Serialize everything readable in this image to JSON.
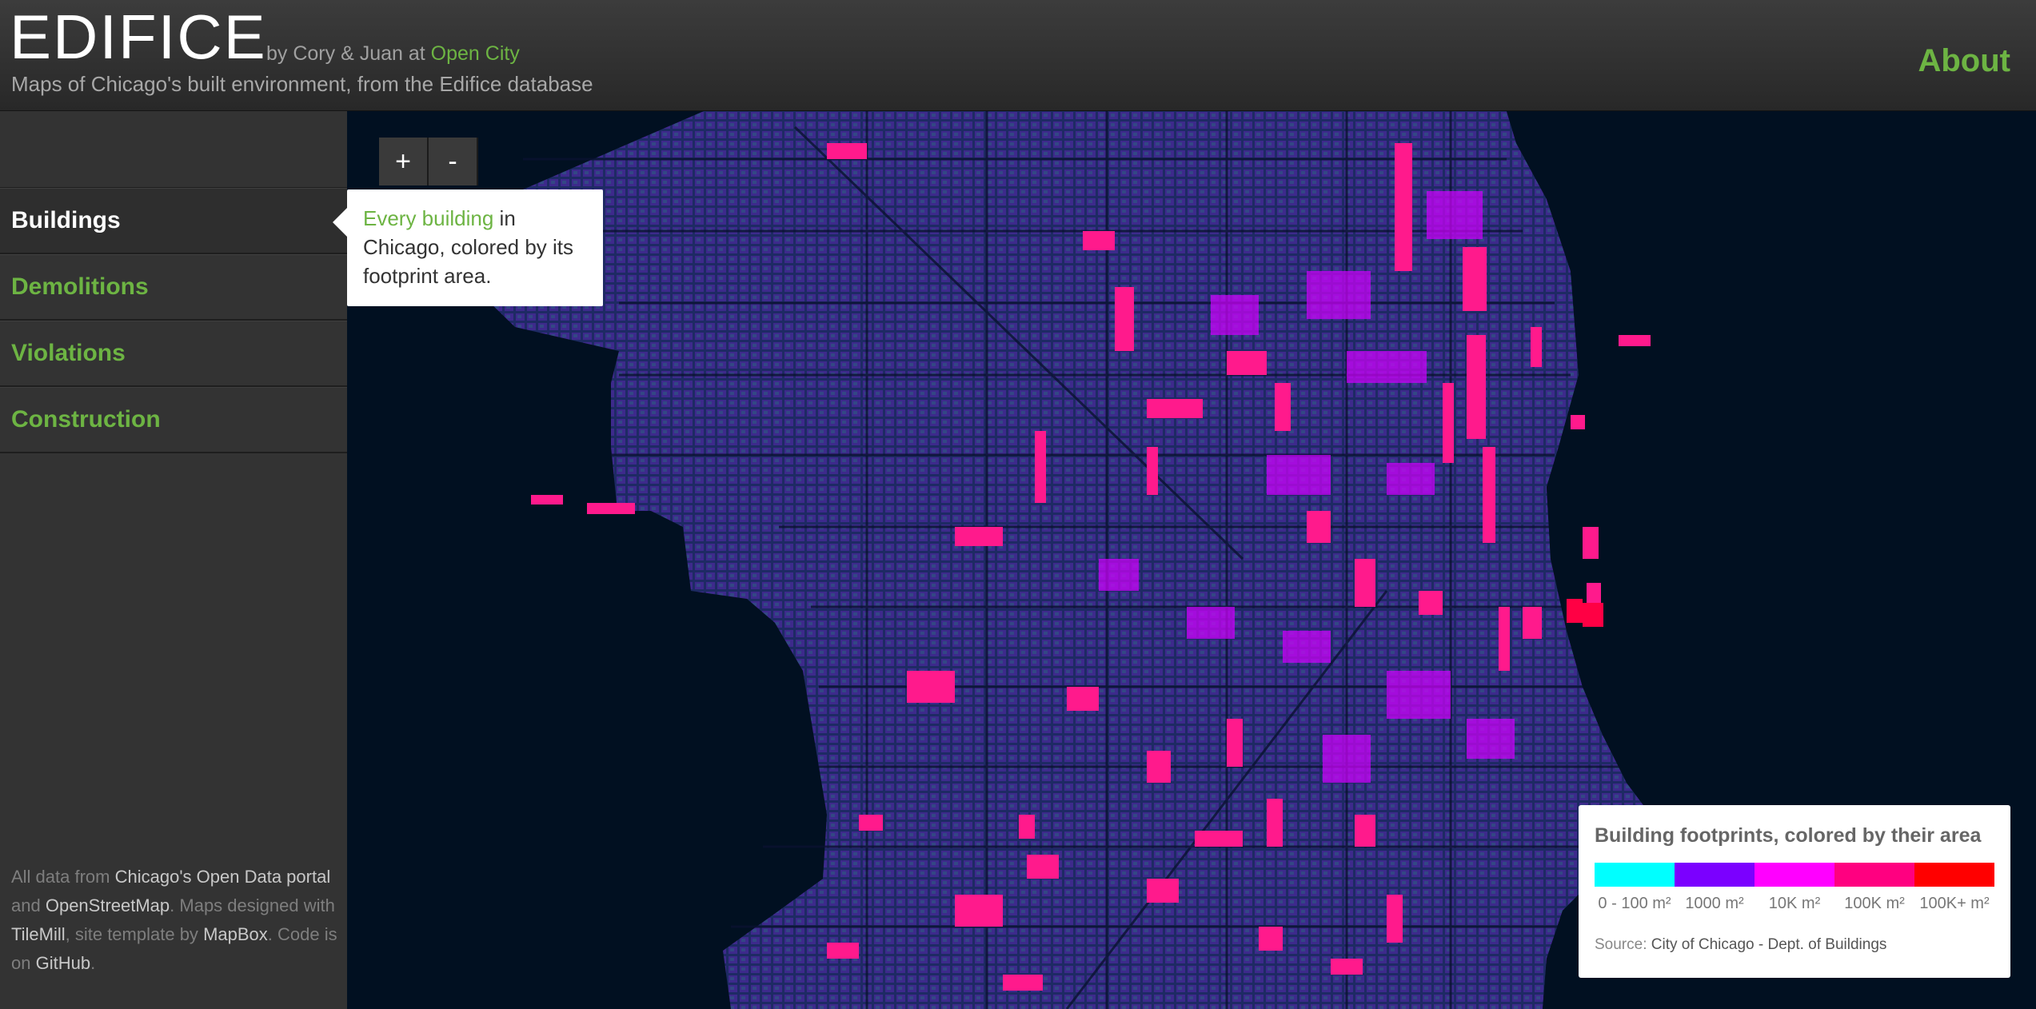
{
  "header": {
    "logo": "EDIFICE",
    "byline_prefix": "by Cory & Juan at",
    "byline_link": "Open City",
    "tagline": "Maps of Chicago's built environment, from the Edifice database",
    "about_label": "About"
  },
  "sidebar": {
    "items": [
      {
        "label": "Buildings",
        "active": true
      },
      {
        "label": "Demolitions",
        "active": false
      },
      {
        "label": "Violations",
        "active": false
      },
      {
        "label": "Construction",
        "active": false
      }
    ],
    "credits": {
      "t1": "All data from",
      "l1": "Chicago's Open Data portal",
      "t2": "and",
      "l2": "OpenStreetMap",
      "t3": ". Maps designed with",
      "l3": "TileMill",
      "t4": ", site template by",
      "l4": "MapBox",
      "t5": ". Code is on",
      "l5": "GitHub",
      "t6": "."
    }
  },
  "map": {
    "zoom_in": "+",
    "zoom_out": "-",
    "tooltip": {
      "link": "Every building",
      "text": "in Chicago, colored by its footprint area."
    },
    "legend": {
      "title": "Building footprints, colored by their area",
      "colors": [
        "#00ffff",
        "#7b00ff",
        "#ff00ff",
        "#ff0080",
        "#ff0000"
      ],
      "labels": [
        "0 - 100 m²",
        "1000 m²",
        "10K m²",
        "100K m²",
        "100K+ m²"
      ],
      "source_prefix": "Source:",
      "source": "City of Chicago - Dept. of Buildings"
    },
    "colors": {
      "water": "#011021",
      "city_base": "#3a2a86",
      "highlight": "#ff1a8c"
    }
  }
}
